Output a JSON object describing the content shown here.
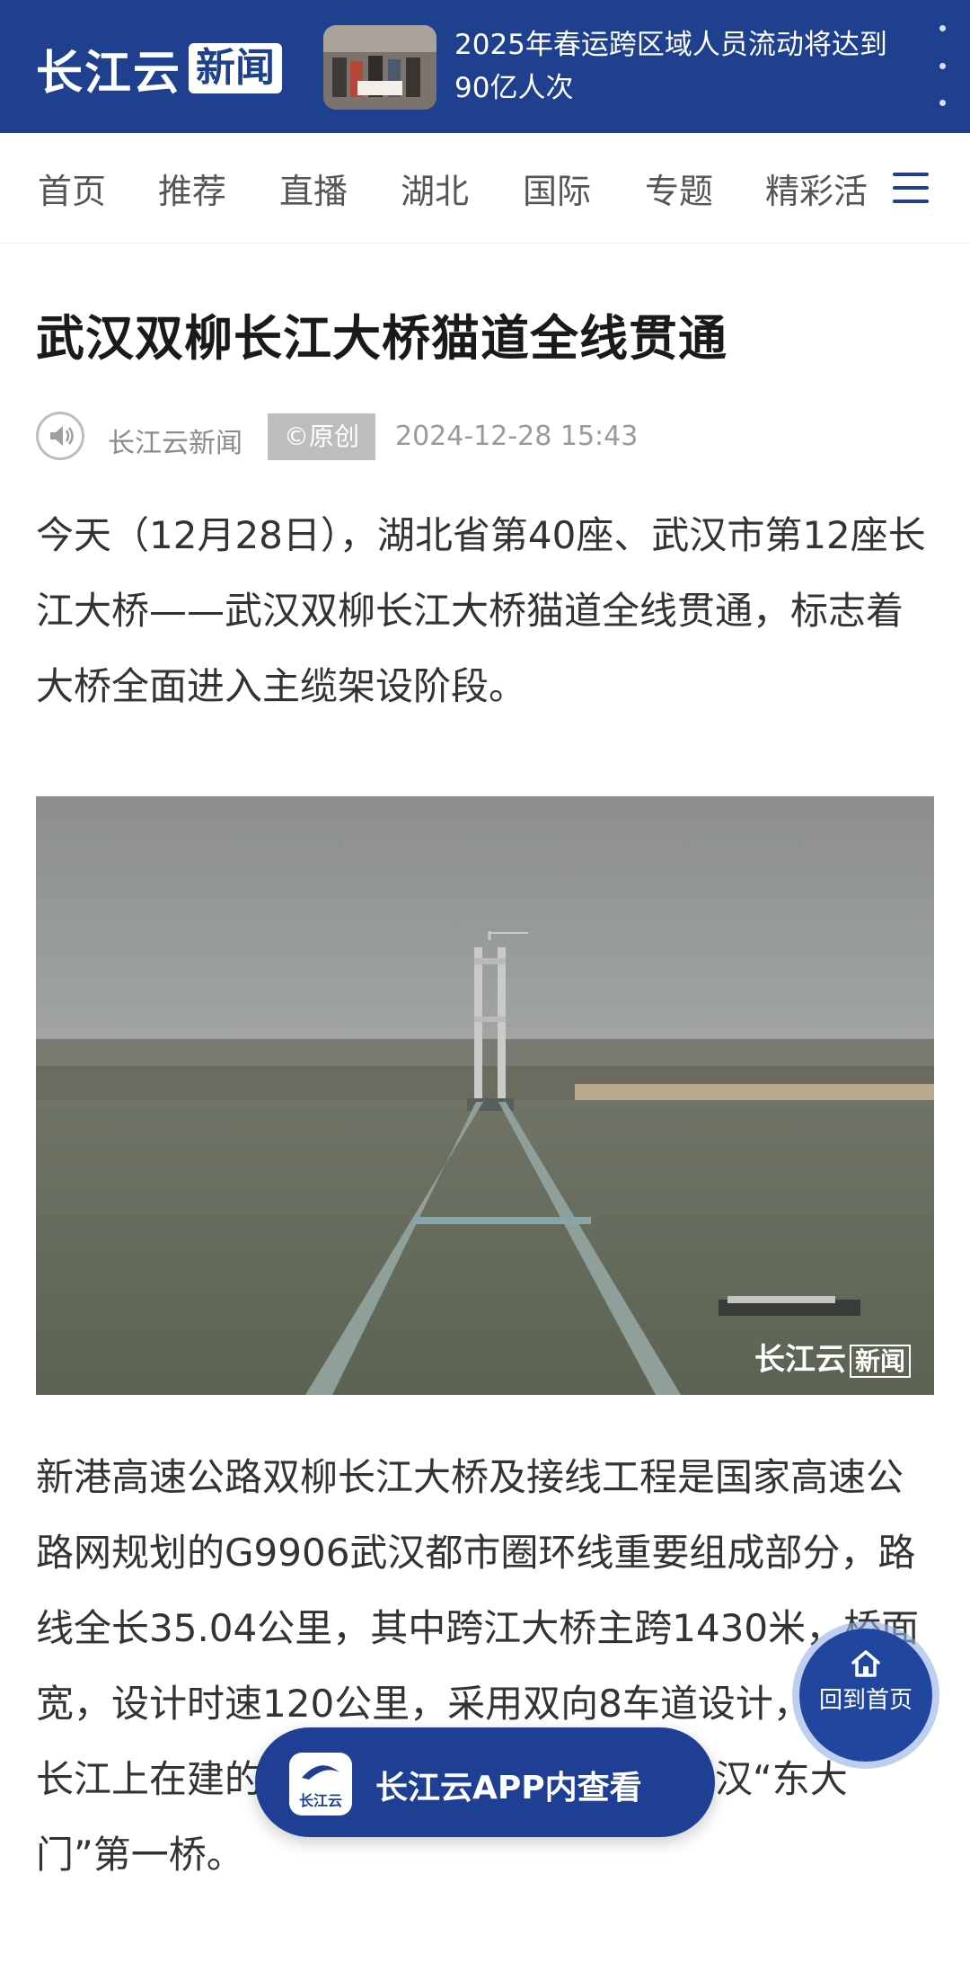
{
  "header": {
    "logo_text": "长江云",
    "logo_tag": "新闻",
    "headline": "2025年春运跨区域人员流动将达到90亿人次"
  },
  "nav": {
    "items": [
      "首页",
      "推荐",
      "直播",
      "湖北",
      "国际",
      "专题",
      "精彩活"
    ]
  },
  "article": {
    "title": "武汉双柳长江大桥猫道全线贯通",
    "source": "长江云新闻",
    "badge": "©原创",
    "date": "2024-12-28 15:43",
    "para1": "今天（12月28日），湖北省第40座、武汉市第12座长江大桥——武汉双柳长江大桥猫道全线贯通，标志着大桥全面进入主缆架设阶段。",
    "photo_watermark": "长江云",
    "photo_watermark_tag": "新闻",
    "para2": "新港高速公路双柳长江大桥及接线工程是国家高速公路网规划的G9906武汉都市圈环线重要组成部分，路线全长35.04公里，其中跨江大桥主跨1430米，桥面宽，设计时速120公里，采用双向8车道设计，是目前长江上在建的最宽钢箱梁悬索桥，也是武汉“东大门”第一桥。"
  },
  "floating": {
    "home_label": "回到首页",
    "app_label": "长江云APP内查看",
    "app_logo_text": "长江云"
  },
  "colors": {
    "brand_blue": "#1f3f8f",
    "text": "#333333"
  }
}
